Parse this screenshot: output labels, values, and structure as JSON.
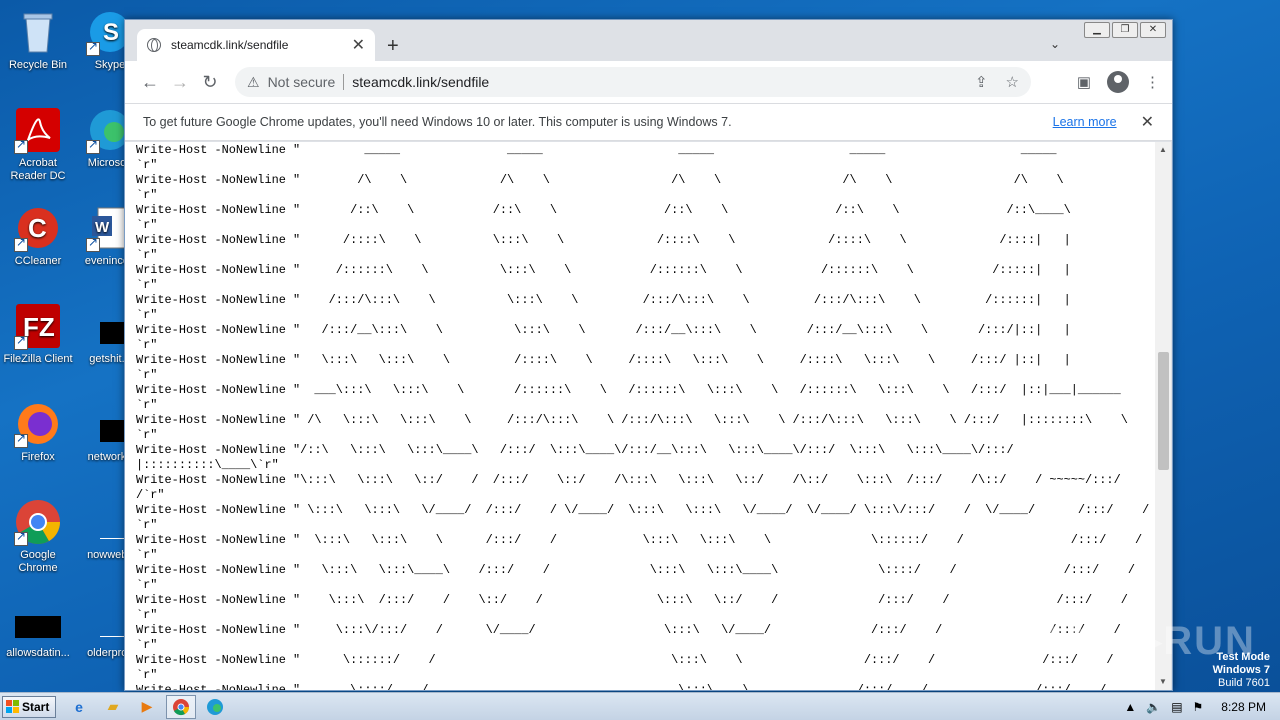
{
  "desktop": {
    "icons": [
      {
        "label": "Recycle Bin"
      },
      {
        "label": "Skype"
      },
      {
        "label": "Acrobat Reader DC"
      },
      {
        "label": "Microsoft"
      },
      {
        "label": "CCleaner"
      },
      {
        "label": "evenincen"
      },
      {
        "label": "FileZilla Client"
      },
      {
        "label": "getshit..."
      },
      {
        "label": "Firefox"
      },
      {
        "label": "networko"
      },
      {
        "label": "Google Chrome"
      },
      {
        "label": "nowwebs"
      },
      {
        "label": "allowsdatin..."
      },
      {
        "label": "olderprov"
      }
    ]
  },
  "browser": {
    "tab_title": "steamcdk.link/sendfile",
    "not_secure": "Not secure",
    "url": "steamcdk.link/sendfile",
    "infobar_message": "To get future Google Chrome updates, you'll need Windows 10 or later. This computer is using Windows 7.",
    "infobar_link": "Learn more",
    "page_text": "Write-Host -NoNewline \"         _____               _____                   _____                   _____                   _____\n`r\"\nWrite-Host -NoNewline \"        /\\    \\             /\\    \\                 /\\    \\                 /\\    \\                 /\\    \\\n`r\"\nWrite-Host -NoNewline \"       /::\\    \\           /::\\    \\               /::\\    \\               /::\\    \\               /::\\____\\\n`r\"\nWrite-Host -NoNewline \"      /::::\\    \\          \\:::\\    \\             /::::\\    \\             /::::\\    \\             /::::|   |\n`r\"\nWrite-Host -NoNewline \"     /::::::\\    \\          \\:::\\    \\           /::::::\\    \\           /::::::\\    \\           /:::::|   |\n`r\"\nWrite-Host -NoNewline \"    /:::/\\:::\\    \\          \\:::\\    \\         /:::/\\:::\\    \\         /:::/\\:::\\    \\         /::::::|   |\n`r\"\nWrite-Host -NoNewline \"   /:::/__\\:::\\    \\          \\:::\\    \\       /:::/__\\:::\\    \\       /:::/__\\:::\\    \\       /:::/|::|   |\n`r\"\nWrite-Host -NoNewline \"   \\:::\\   \\:::\\    \\         /::::\\    \\     /::::\\   \\:::\\    \\     /::::\\   \\:::\\    \\     /:::/ |::|   |\n`r\"\nWrite-Host -NoNewline \"  ___\\:::\\   \\:::\\    \\       /::::::\\    \\   /::::::\\   \\:::\\    \\   /::::::\\   \\:::\\    \\   /:::/  |::|___|______\n`r\"\nWrite-Host -NoNewline \" /\\   \\:::\\   \\:::\\    \\     /:::/\\:::\\    \\ /:::/\\:::\\   \\:::\\    \\ /:::/\\:::\\   \\:::\\    \\ /:::/   |::::::::\\    \\\n`r\"\nWrite-Host -NoNewline \"/::\\   \\:::\\   \\:::\\____\\   /:::/  \\:::\\____\\/:::/__\\:::\\   \\:::\\____\\/:::/  \\:::\\   \\:::\\____\\/:::/\n|::::::::::\\____\\`r\"\nWrite-Host -NoNewline \"\\:::\\   \\:::\\   \\::/    /  /:::/    \\::/    /\\:::\\   \\:::\\   \\::/    /\\::/    \\:::\\  /:::/    /\\::/    / ~~~~~/:::/\n/`r\"\nWrite-Host -NoNewline \" \\:::\\   \\:::\\   \\/____/  /:::/    / \\/____/  \\:::\\   \\:::\\   \\/____/  \\/____/ \\:::\\/:::/    /  \\/____/      /:::/    /\n`r\"\nWrite-Host -NoNewline \"  \\:::\\   \\:::\\    \\      /:::/    /            \\:::\\   \\:::\\    \\              \\::::::/    /               /:::/    /\n`r\"\nWrite-Host -NoNewline \"   \\:::\\   \\:::\\____\\    /:::/    /              \\:::\\   \\:::\\____\\              \\::::/    /               /:::/    /\n`r\"\nWrite-Host -NoNewline \"    \\:::\\  /:::/    /    \\::/    /                \\:::\\   \\::/    /              /:::/    /               /:::/    /\n`r\"\nWrite-Host -NoNewline \"     \\:::\\/:::/    /      \\/____/                  \\:::\\   \\/____/              /:::/    /               /:::/    /\n`r\"\nWrite-Host -NoNewline \"      \\::::::/    /                                 \\:::\\    \\                 /:::/    /               /:::/    /\n`r\"\nWrite-Host -NoNewline \"       \\::::/    /                                   \\:::\\    \\               /:::/    /               /:::/    /"
  },
  "watermark": {
    "line1": "Test Mode",
    "line2": "Windows 7",
    "line3": "Build 7601",
    "brand": "ANY.RUN"
  },
  "taskbar": {
    "start_label": "Start",
    "clock": "8:28 PM"
  }
}
